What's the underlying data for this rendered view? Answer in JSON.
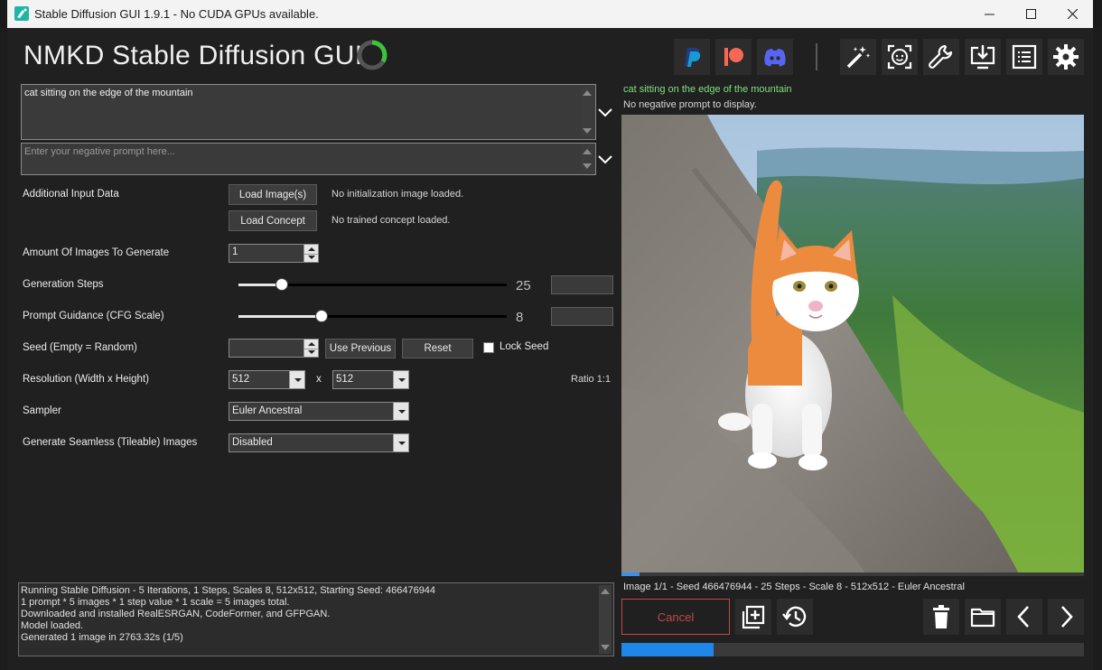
{
  "window": {
    "title": "Stable Diffusion GUI 1.9.1 - No CUDA GPUs available."
  },
  "header": {
    "app_title": "NMKD Stable Diffusion GUI",
    "buttons": [
      {
        "icon": "paypal-icon",
        "color": "#253b80"
      },
      {
        "icon": "patreon-icon",
        "color": "#f96854"
      },
      {
        "icon": "discord-icon",
        "color": "#5865f2"
      },
      {
        "icon": "magic-wand-icon"
      },
      {
        "icon": "face-restore-icon"
      },
      {
        "icon": "wrench-icon"
      },
      {
        "icon": "install-icon"
      },
      {
        "icon": "logs-icon"
      },
      {
        "icon": "settings-gear-icon"
      }
    ]
  },
  "prompt": {
    "value": "cat sitting on the edge of the mountain",
    "negative_placeholder": "Enter your negative prompt here..."
  },
  "form": {
    "additional_input_label": "Additional Input Data",
    "load_images_label": "Load Image(s)",
    "no_init_image": "No initialization image loaded.",
    "load_concept_label": "Load Concept",
    "no_concept": "No trained concept loaded.",
    "amount_label": "Amount Of Images To Generate",
    "amount_value": "1",
    "steps_label": "Generation Steps",
    "steps_value": "25",
    "steps_fraction": 0.16,
    "cfg_label": "Prompt Guidance (CFG Scale)",
    "cfg_value": "8",
    "cfg_fraction": 0.31,
    "seed_label": "Seed (Empty = Random)",
    "seed_value": "",
    "use_previous_label": "Use Previous",
    "reset_label": "Reset",
    "lock_seed_label": "Lock Seed",
    "lock_seed_checked": false,
    "resolution_label": "Resolution (Width x Height)",
    "width": "512",
    "height": "512",
    "x_sep": "x",
    "ratio": "Ratio 1:1",
    "sampler_label": "Sampler",
    "sampler_value": "Euler Ancestral",
    "seamless_label": "Generate Seamless (Tileable) Images",
    "seamless_value": "Disabled"
  },
  "log": {
    "lines": [
      "Running Stable Diffusion - 5 Iterations, 1 Steps, Scales 8, 512x512, Starting Seed: 466476944",
      "1 prompt * 5 images * 1 step value * 1 scale = 5 images total.",
      "Downloaded and installed RealESRGAN, CodeFormer, and GFPGAN.",
      "Model loaded.",
      "Generated 1 image in 2763.32s (1/5)"
    ]
  },
  "preview": {
    "prompt": "cat sitting on the edge of the mountain",
    "negative": "No negative prompt to display.",
    "info": "Image 1/1 - Seed 466476944 - 25 Steps - Scale 8 - 512x512 - Euler Ancestral",
    "thin_progress": 0.04
  },
  "actions": {
    "cancel_label": "Cancel",
    "progress": 0.2
  },
  "colors": {
    "accent_blue": "#1f86ea",
    "cancel_red": "#c24848",
    "prompt_green": "#7fe07f"
  }
}
